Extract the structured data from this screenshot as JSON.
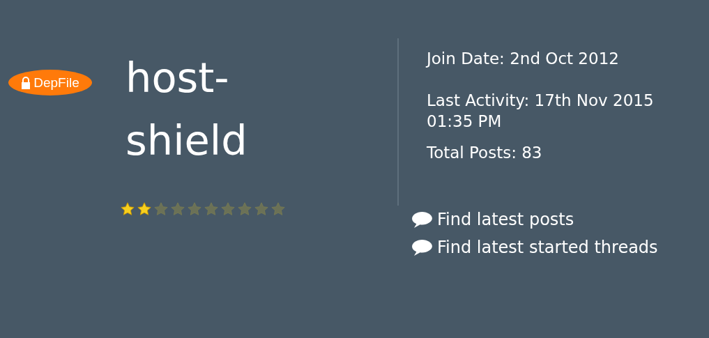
{
  "logo": {
    "text": "DepFile"
  },
  "profile": {
    "username": "host-shield",
    "stars": 2
  },
  "info": [
    "Join Date: 2nd Oct 2012",
    "Last Activity: 17th Nov 2015 01:35 PM",
    "Total Posts: 83"
  ],
  "links": [
    "Find latest posts",
    "Find latest started threads"
  ]
}
